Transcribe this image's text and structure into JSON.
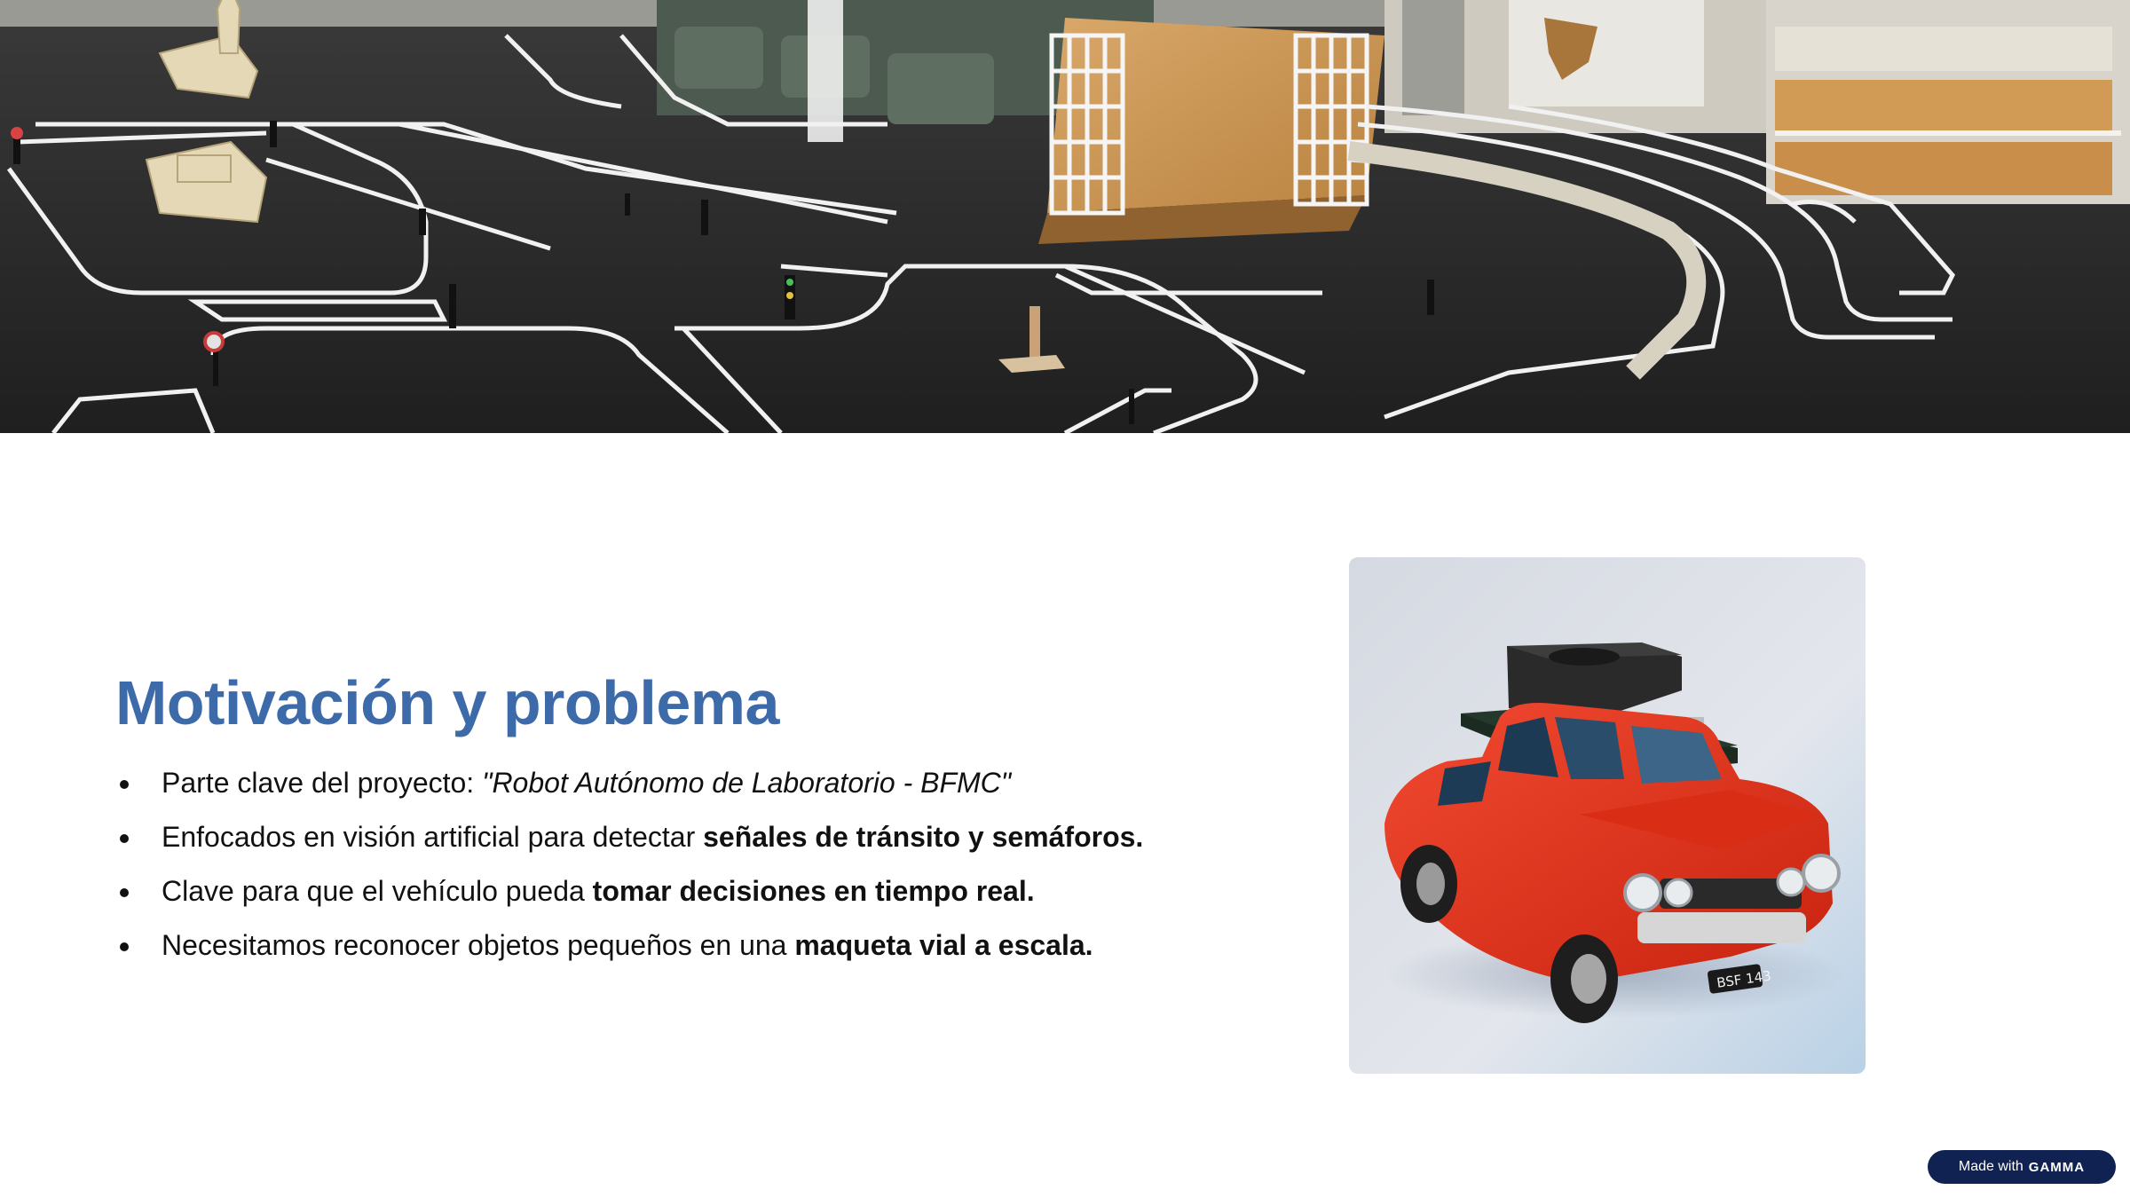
{
  "slide": {
    "title": "Motivación y problema",
    "bullets": [
      {
        "text": "Parte clave del proyecto: ",
        "emphasis": "\"Robot Autónomo de Laboratorio - BFMC\""
      },
      {
        "text": "Enfocados en visión artificial para detectar ",
        "emphasis": "señales de tránsito y semáforos."
      },
      {
        "text": "Clave para que el vehículo pueda ",
        "emphasis": "tomar decisiones en tiempo real."
      },
      {
        "text": "Necesitamos reconocer objetos pequeños en una ",
        "emphasis": "maqueta vial a escala."
      }
    ]
  },
  "images": {
    "banner": "scale-road-track-photo",
    "card": "red-car-with-compute-board-photo",
    "car_plate": "BSF 143"
  },
  "badge": {
    "prefix": "Made with",
    "brand": "GAMMA"
  },
  "colors": {
    "title": "#3d6aa8",
    "text": "#111111",
    "badge_bg": "#0f2251",
    "car_red": "#e2301f"
  }
}
